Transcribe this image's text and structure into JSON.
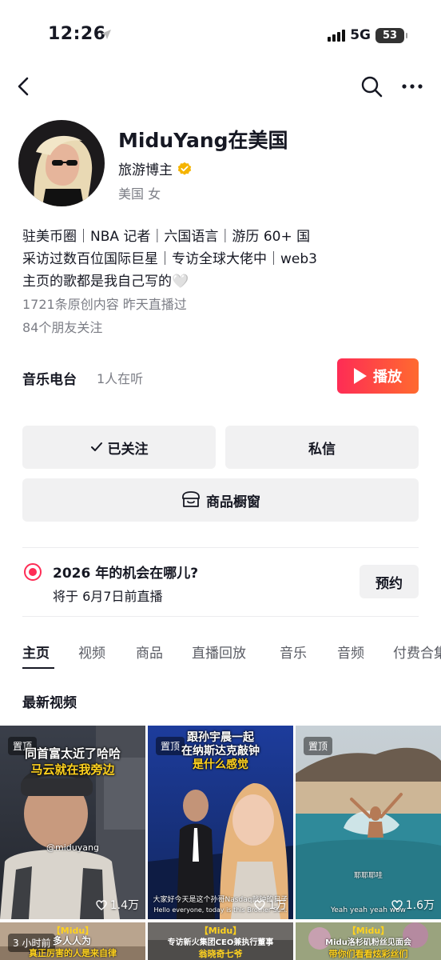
{
  "status_bar": {
    "time": "12:26",
    "network": "5G",
    "battery": "53"
  },
  "profile": {
    "name": "MiduYang在美国",
    "role": "旅游博主",
    "meta": "美国  女",
    "bio_lines": [
      "驻美币圈｜NBA 记者｜六国语言｜游历 60+ 国",
      "采访过数百位国际巨星｜专访全球大佬中｜web3",
      "主页的歌都是我自己写的🤍"
    ],
    "content_stats": "1721条原创内容   昨天直播过",
    "friends_following": "84个朋友关注"
  },
  "radio": {
    "label": "音乐电台",
    "listeners": "1人在听",
    "play_label": "播放"
  },
  "actions": {
    "follow_label": "已关注",
    "message_label": "私信",
    "shop_label": "商品橱窗"
  },
  "live": {
    "title": "2026 年的机会在哪儿?",
    "subtitle": "将于 6月7日前直播",
    "reserve_label": "预约"
  },
  "tabs": [
    {
      "label": "主页",
      "active": true
    },
    {
      "label": "视频"
    },
    {
      "label": "商品"
    },
    {
      "label": "直播回放"
    },
    {
      "label": "音乐"
    },
    {
      "label": "音频"
    },
    {
      "label": "付费合集"
    }
  ],
  "section_title": "最新视频",
  "videos": [
    {
      "badge": "置顶",
      "caption_line1": "同首富太近了哈哈",
      "caption_line2": "马云就在我旁边",
      "watermark": "@miduyang",
      "likes": "1.4万"
    },
    {
      "badge": "置顶",
      "caption_line1": "跟孙宇晨一起",
      "caption_line2": "在纳斯达克敲钟",
      "caption_line3": "是什么感觉",
      "subtitle_cn": "大家好今天是这个孙哥Nasdaq敲钟的日子",
      "subtitle_en": "Hello everyone, today is this Brother Sun.",
      "likes": "1万"
    },
    {
      "badge": "置顶",
      "subtitle_cn": "耶耶耶哇",
      "subtitle_en": "Yeah yeah yeah wow",
      "likes": "1.6万"
    }
  ],
  "videos_row2": [
    {
      "time_badge": "3 小时前",
      "caption_line1": "【Midu】",
      "caption_line2": "多人人为",
      "caption_line3": "真正厉害的人是来自律"
    },
    {
      "caption_line1": "【Midu】",
      "caption_line2": "专访新火集团CEO兼执行董事",
      "caption_line3": "翁晓奇七爷"
    },
    {
      "caption_line1": "【Midu】",
      "caption_line2": "Midu洛杉矶粉丝见面会",
      "caption_line3": "带你们看看炫彩丝们"
    }
  ]
}
